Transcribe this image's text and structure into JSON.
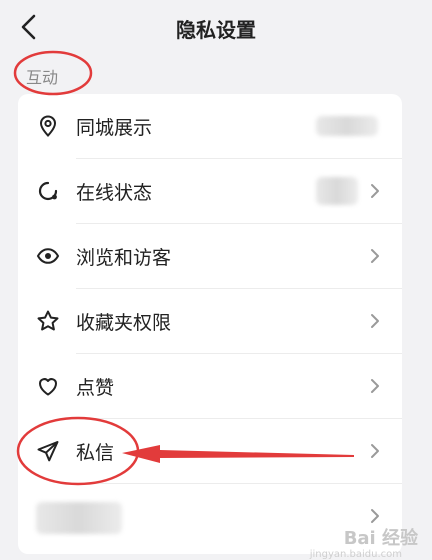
{
  "header": {
    "title": "隐私设置",
    "back_icon": "chevron-left-icon"
  },
  "section": {
    "label": "互动"
  },
  "rows": [
    {
      "label": "同城展示",
      "icon": "location-pin-icon"
    },
    {
      "label": "在线状态",
      "icon": "online-status-icon"
    },
    {
      "label": "浏览和访客",
      "icon": "eye-icon"
    },
    {
      "label": "收藏夹权限",
      "icon": "star-icon"
    },
    {
      "label": "点赞",
      "icon": "heart-icon"
    },
    {
      "label": "私信",
      "icon": "paper-plane-icon"
    }
  ],
  "watermark": {
    "text": "Bai 经验",
    "sub": "jingyan.baidu.com"
  },
  "colors": {
    "annotation": "#e23b3b",
    "background": "#f2f2f4",
    "card": "#ffffff"
  }
}
